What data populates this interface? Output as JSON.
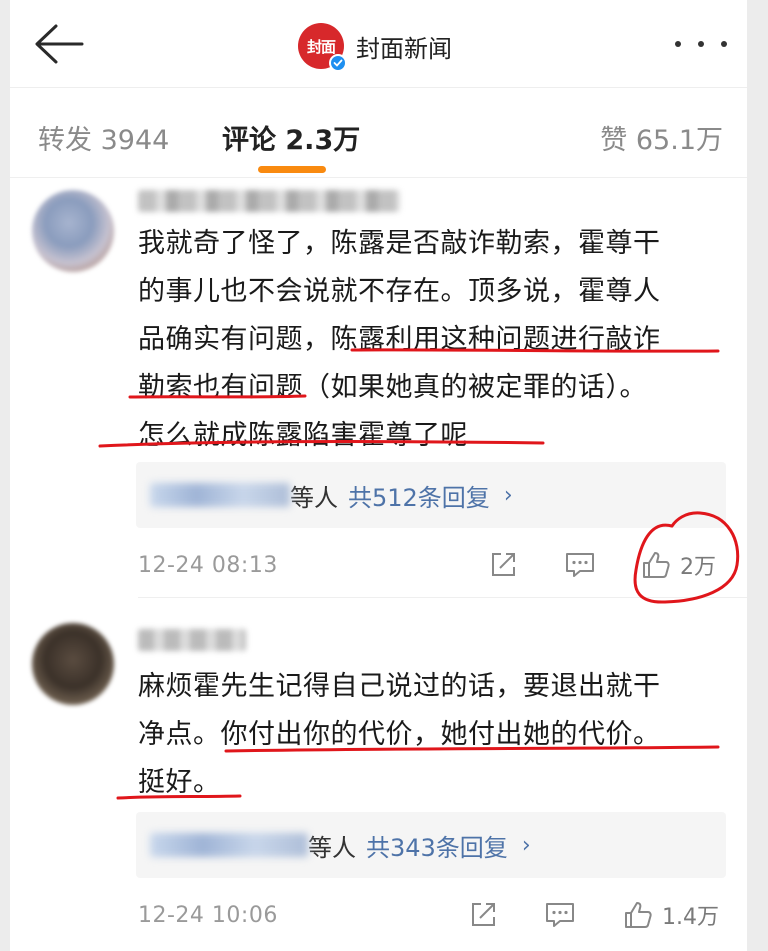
{
  "header": {
    "back_icon": "arrow-left-icon",
    "logo_text": "封面",
    "title": "封面新闻",
    "more_icon": "more-horizontal-icon",
    "verified_icon": "verified-badge-icon"
  },
  "tabs": [
    {
      "label": "转发 3944",
      "active": false
    },
    {
      "label": "评论 2.3万",
      "active": true
    },
    {
      "label": "赞 65.1万",
      "active": false
    }
  ],
  "colors": {
    "accent": "#f98a10",
    "link": "#4e73a8",
    "annotation": "#e0161b",
    "logo": "#d7282b"
  },
  "comments": [
    {
      "text_lines": [
        "我就奇了怪了，陈露是否敲诈勒索，霍尊干",
        "的事儿也不会说就不存在。顶多说，霍尊人",
        "品确实有问题，陈露利用这种问题进行敲诈",
        "勒索也有问题（如果她真的被定罪的话）。",
        "怎么就成陈露陷害霍尊了呢"
      ],
      "reply_who": "等人",
      "reply_count": "共512条回复",
      "reply_arrow": "›",
      "time": "12-24 08:13",
      "likes": "2万"
    },
    {
      "text_lines": [
        "麻烦霍先生记得自己说过的话，要退出就干",
        "净点。你付出你的代价，她付出她的代价。",
        "挺好。"
      ],
      "reply_who": "等人",
      "reply_count": "共343条回复",
      "reply_arrow": "›",
      "time": "12-24 10:06",
      "likes": "1.4万"
    }
  ]
}
